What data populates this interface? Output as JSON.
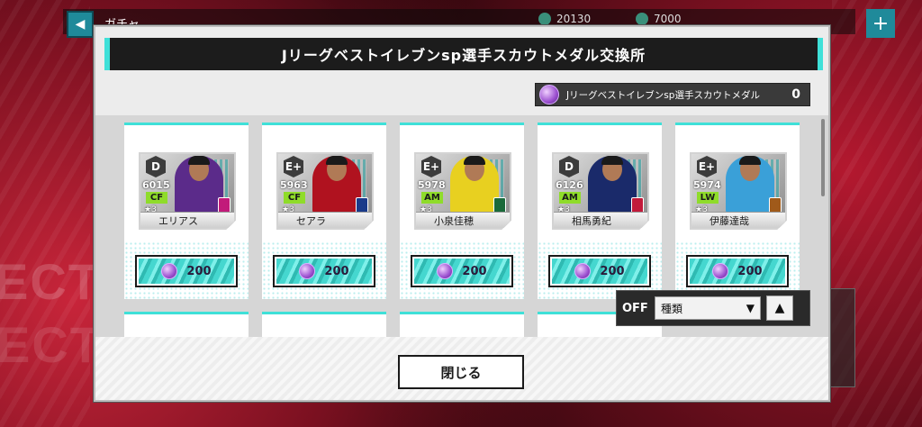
{
  "background": {
    "title": "ガチャ",
    "currency_1": "20130",
    "currency_2": "7000",
    "word": "ECT"
  },
  "modal": {
    "title": "Jリーグベストイレブンsp選手スカウトメダル交換所",
    "medal_label": "Jリーグベストイレブンsp選手スカウトメダル",
    "medal_count": "0",
    "close_label": "閉じる"
  },
  "filter": {
    "toggle_label": "OFF",
    "select_value": "種類",
    "select_arrow": "▼",
    "sort_icon": "▲"
  },
  "players": [
    {
      "rank": "D",
      "ovr": "6015",
      "position": "CF",
      "stars": "★3",
      "name": "エリアス",
      "cost": "200",
      "kit": "#5b2b8a",
      "club": "#c21a7a"
    },
    {
      "rank": "E+",
      "ovr": "5963",
      "position": "CF",
      "stars": "★3",
      "name": "セアラ",
      "cost": "200",
      "kit": "#b0121f",
      "club": "#1a3a8a"
    },
    {
      "rank": "E+",
      "ovr": "5978",
      "position": "AM",
      "stars": "★3",
      "name": "小泉佳穂",
      "cost": "200",
      "kit": "#e8d020",
      "club": "#1a6a3a"
    },
    {
      "rank": "D",
      "ovr": "6126",
      "position": "AM",
      "stars": "★3",
      "name": "相馬勇紀",
      "cost": "200",
      "kit": "#1a2a6a",
      "club": "#c21a3a"
    },
    {
      "rank": "E+",
      "ovr": "5974",
      "position": "LW",
      "stars": "★3",
      "name": "伊藤達哉",
      "cost": "200",
      "kit": "#3aa0d8",
      "club": "#a05a1a"
    }
  ],
  "colors": {
    "accent": "#3fe0d8",
    "header_bg": "#1c1c1c",
    "medal": "#9b4fcf",
    "position_badge": "#8fdc2a"
  }
}
